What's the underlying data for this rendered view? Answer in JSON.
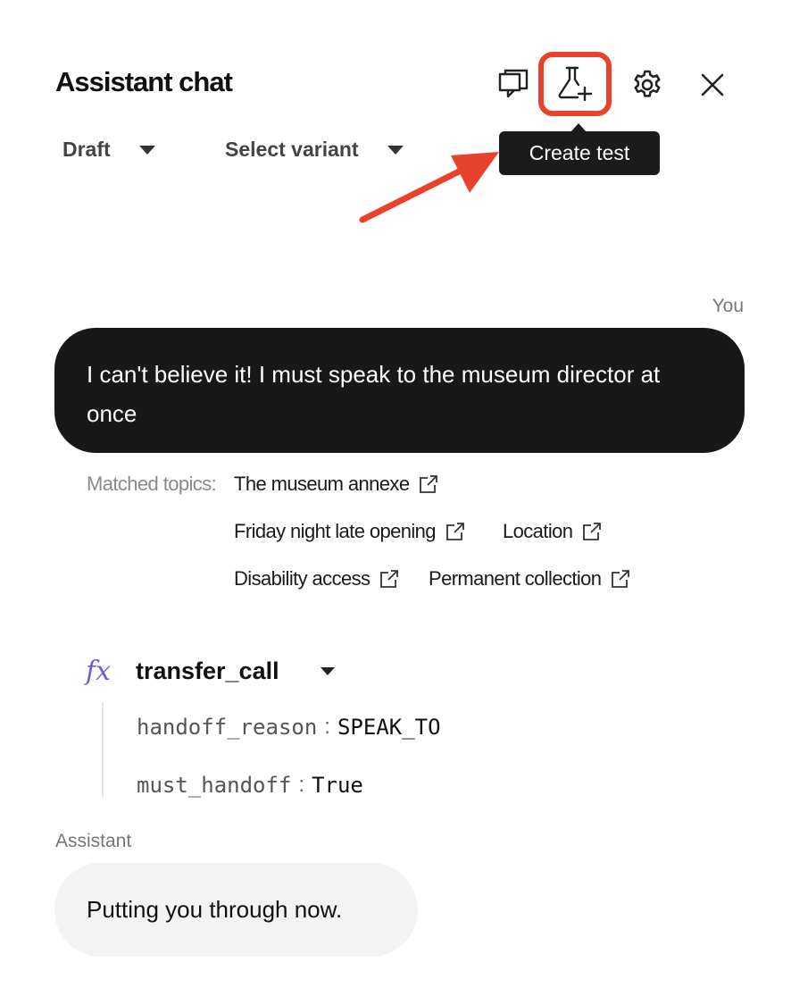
{
  "header": {
    "title": "Assistant chat",
    "tooltip": "Create test",
    "accent_color": "#e8412c"
  },
  "icons": {
    "chat": "chat-bubbles-icon",
    "test": "flask-plus-icon",
    "settings": "gear-icon",
    "close": "close-icon"
  },
  "filters": {
    "draft": "Draft",
    "variant": "Select variant"
  },
  "conversation": {
    "user_label": "You",
    "user_message": "I can't believe it! I must speak to the museum director at once",
    "matched_label": "Matched topics:",
    "topics": [
      "The museum annexe",
      "Friday night late opening",
      "Location",
      "Disability access",
      "Permanent collection"
    ],
    "function": {
      "badge": "fx",
      "name": "transfer_call",
      "params": [
        {
          "key": "handoff_reason",
          "sep": ":",
          "value": "SPEAK_TO"
        },
        {
          "key": "must_handoff",
          "sep": ":",
          "value": "True"
        }
      ]
    },
    "assistant_label": "Assistant",
    "assistant_message": "Putting you through now."
  }
}
